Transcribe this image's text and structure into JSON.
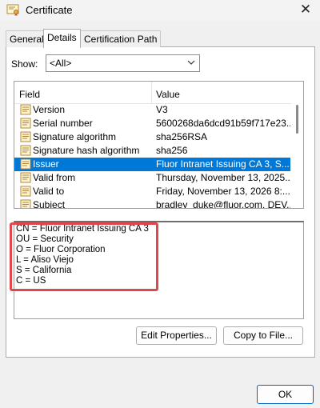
{
  "window": {
    "title": "Certificate",
    "close_glyph": "✕"
  },
  "tabs": [
    {
      "label": "General"
    },
    {
      "label": "Details"
    },
    {
      "label": "Certification Path"
    }
  ],
  "show": {
    "label": "Show:",
    "value": "<All>"
  },
  "list": {
    "headers": {
      "field": "Field",
      "value": "Value"
    },
    "rows": [
      {
        "field": "Version",
        "value": "V3"
      },
      {
        "field": "Serial number",
        "value": "5600268da6dcd91b59f717e23..."
      },
      {
        "field": "Signature algorithm",
        "value": "sha256RSA"
      },
      {
        "field": "Signature hash algorithm",
        "value": "sha256"
      },
      {
        "field": "Issuer",
        "value": "Fluor Intranet Issuing CA 3, S..."
      },
      {
        "field": "Valid from",
        "value": "Thursday, November 13, 2025..."
      },
      {
        "field": "Valid to",
        "value": "Friday, November 13, 2026 8:..."
      },
      {
        "field": "Subject",
        "value": "bradley_duke@fluor.com, DEV..."
      }
    ],
    "selected_index": 4
  },
  "detail": {
    "lines": [
      "CN = Fluor Intranet Issuing CA 3",
      "OU = Security",
      "O = Fluor Corporation",
      "L = Aliso Viejo",
      "S = California",
      "C = US"
    ]
  },
  "buttons": {
    "edit_properties": "Edit Properties...",
    "copy_to_file": "Copy to File...",
    "ok": "OK"
  },
  "colors": {
    "selection": "#0078d7",
    "highlight_box": "#e0474c"
  },
  "icons": {
    "title": "certificate-icon",
    "field": "field-document-icon",
    "dropdown": "chevron-down-icon"
  }
}
